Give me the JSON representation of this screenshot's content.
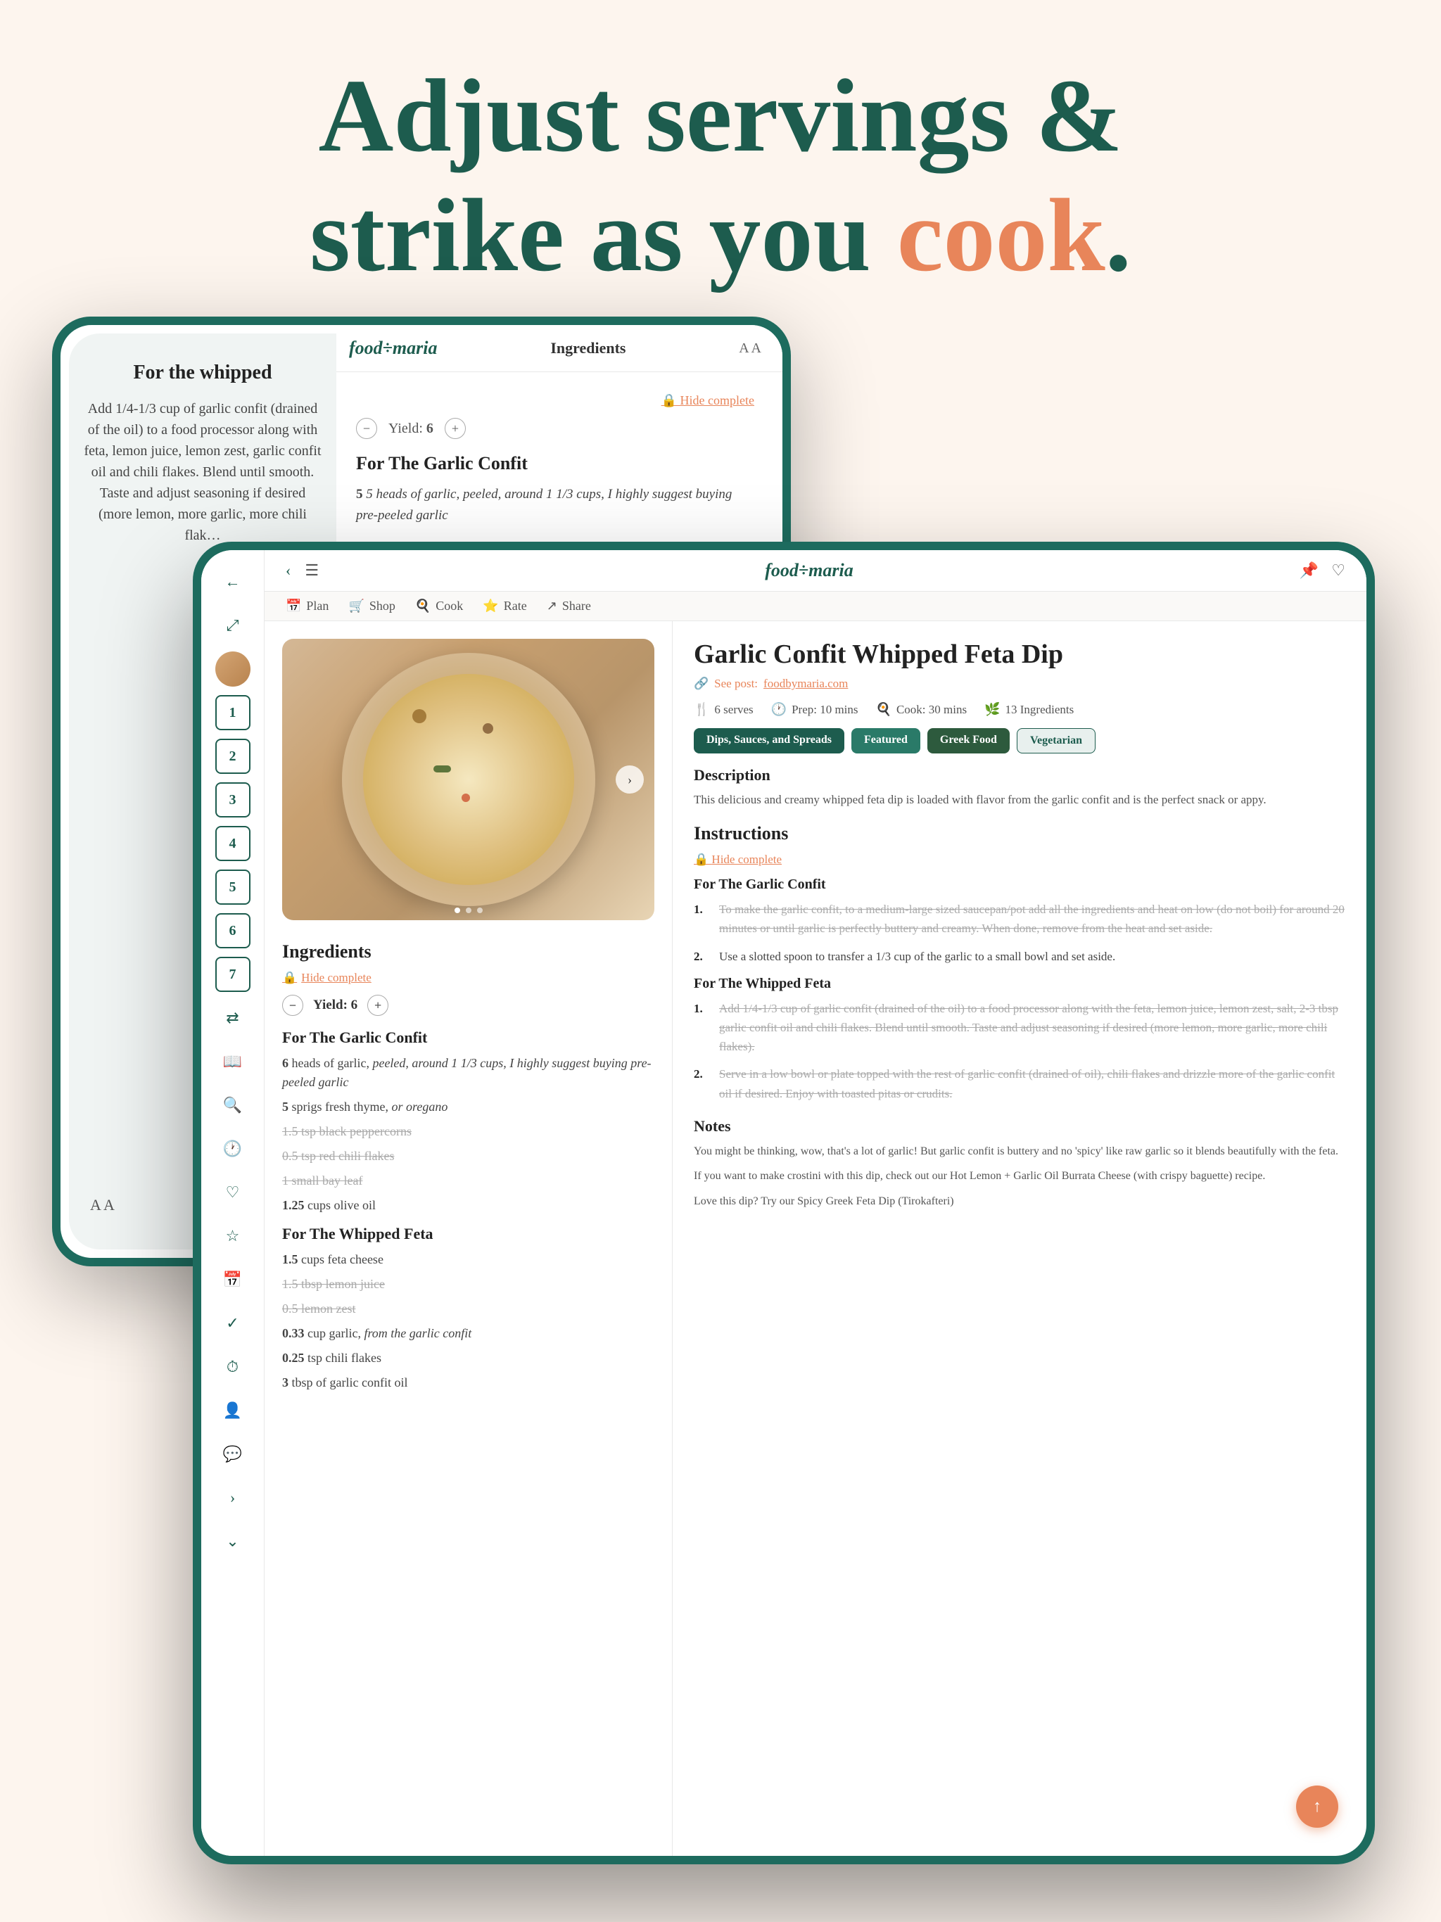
{
  "hero": {
    "line1": "Adjust servings &",
    "line2": "strike as you ",
    "highlight": "cook",
    "period": "."
  },
  "back_tablet": {
    "header": {
      "logo": "food÷maria",
      "tab": "Ingredients",
      "aa": "A A"
    },
    "yield": {
      "label": "Yield:",
      "value": "6"
    },
    "section": "For The Garlic Confit",
    "ingredient": "5 heads of garlic, peeled, around 1 1/3 cups, I highly suggest buying pre-peeled garlic",
    "left_panel": {
      "title": "For the whipped",
      "text": "Add 1/4-1/3 cup of garlic confit (drained of the oil) to a food processor along with feta, lemon juice, lemon zest, garlic confit oil and chili flakes. Blend until smooth. Taste and adjust seasoning if desired (more lemon, more garlic, more chili flak…",
      "aa": "A A"
    }
  },
  "front_tablet": {
    "top_nav": {
      "logo": "food÷maria",
      "pin_icon": "📌",
      "heart_icon": "♡"
    },
    "action_tabs": [
      {
        "icon": "📅",
        "label": "Plan"
      },
      {
        "icon": "🛒",
        "label": "Shop"
      },
      {
        "icon": "🍳",
        "label": "Cook"
      },
      {
        "icon": "⭐",
        "label": "Rate"
      },
      {
        "icon": "↗",
        "label": "Share"
      }
    ],
    "recipe": {
      "title": "Garlic Confit Whipped Feta Dip",
      "source_label": "See post:",
      "source_link": "foodbymaria.com",
      "meta": {
        "serves": "6 serves",
        "prep": "Prep: 10 mins",
        "cook": "Cook: 30 mins",
        "ingredients_count": "13 Ingredients"
      },
      "tags": [
        "Dips, Sauces, and Spreads",
        "Featured",
        "Greek Food",
        "Vegetarian"
      ],
      "description_title": "Description",
      "description": "This delicious and creamy whipped feta dip is loaded with flavor from the garlic confit and is the perfect snack or appy.",
      "ingredients_header": "Ingredients",
      "hide_complete": "Hide complete",
      "yield_label": "Yield:",
      "yield_value": "6",
      "sections": [
        {
          "name": "For The Garlic Confit",
          "items": [
            {
              "text": "6 heads of garlic, peeled, around 1 1/3 cups, I highly suggest buying pre-peeled garlic",
              "strikethrough": false
            },
            {
              "text": "5 sprigs fresh thyme, or oregano",
              "strikethrough": false
            },
            {
              "text": "1.5 tsp black peppercorns",
              "strikethrough": true
            },
            {
              "text": "0.5 tsp red chili flakes",
              "strikethrough": true
            },
            {
              "text": "1 small bay leaf",
              "strikethrough": true
            },
            {
              "text": "1.25 cups olive oil",
              "strikethrough": false
            }
          ]
        },
        {
          "name": "For The Whipped Feta",
          "items": [
            {
              "text": "1.5 cups feta cheese",
              "strikethrough": false
            },
            {
              "text": "1.5 tbsp lemon juice",
              "strikethrough": true
            },
            {
              "text": "0.5 lemon zest",
              "strikethrough": true
            },
            {
              "text": "0.33 cup garlic, from the garlic confit",
              "strikethrough": false
            },
            {
              "text": "0.25 tsp chili flakes",
              "strikethrough": false
            },
            {
              "text": "3 tbsp of garlic confit oil",
              "strikethrough": false
            }
          ]
        }
      ],
      "instructions_header": "Instructions",
      "instructions_hide_complete": "Hide complete",
      "instruction_sections": [
        {
          "name": "For The Garlic Confit",
          "steps": [
            {
              "num": "1.",
              "text": "To make the garlic confit, to a medium-large sized saucepan/pot add all the ingredients and heat on low (do not boil) for around 20 minutes or until garlic is perfectly buttery and creamy. When done, remove from the heat and set aside.",
              "strikethrough": true
            },
            {
              "num": "2.",
              "text": "Use a slotted spoon to transfer a 1/3 cup of the garlic to a small bowl and set aside.",
              "strikethrough": false
            }
          ]
        },
        {
          "name": "For The Whipped Feta",
          "steps": [
            {
              "num": "1.",
              "text": "Add 1/4-1/3 cup of garlic confit (drained of the oil) to a food processor along with the feta, lemon juice, lemon zest, salt, 2-3 tbsp garlic confit oil and chili flakes. Blend until smooth. Taste and adjust seasoning if desired (more lemon, more garlic, more chili flakes).",
              "strikethrough": true
            },
            {
              "num": "2.",
              "text": "Serve in a low bowl or plate topped with the rest of garlic confit (drained of oil), chili flakes and drizzle more of the garlic confit oil if desired. Enjoy with toasted pitas or crudits.",
              "strikethrough": true
            }
          ]
        }
      ],
      "notes_title": "Notes",
      "notes": [
        "You might be thinking, wow, that's a lot of garlic! But garlic confit is buttery and no 'spicy' like raw garlic so it blends beautifully with the feta.",
        "If you want to make crostini with this dip, check out our Hot Lemon + Garlic Oil Burrata Cheese (with crispy baguette) recipe.",
        "Love this dip? Try our Spicy Greek Feta Dip (Tirokafteri)"
      ]
    },
    "sidebar_numbers": [
      "1",
      "2",
      "3",
      "4",
      "5",
      "6",
      "7"
    ]
  }
}
